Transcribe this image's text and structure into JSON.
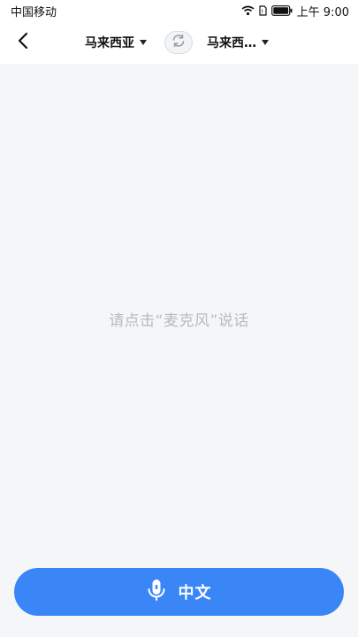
{
  "status_bar": {
    "carrier": "中国移动",
    "time": "上午 9:00",
    "icons": [
      "wifi-icon",
      "sim-icon",
      "battery-icon"
    ]
  },
  "nav": {
    "back_icon": "chevron-left-icon",
    "source_language": "马来西亚",
    "target_language": "马来西…",
    "swap_icon": "swap-icon"
  },
  "main": {
    "hint": "请点击“麦克风”说话"
  },
  "bottom": {
    "mic_icon": "microphone-icon",
    "button_label": "中文"
  },
  "colors": {
    "accent": "#3a86f7",
    "background": "#f5f6f8",
    "hint_text": "#b8babd"
  }
}
